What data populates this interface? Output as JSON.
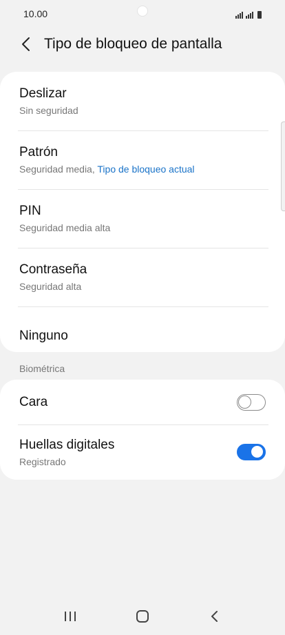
{
  "status_bar": {
    "time": "10.00"
  },
  "header": {
    "title": "Tipo de bloqueo de pantalla"
  },
  "lock_types": [
    {
      "title": "Deslizar",
      "subtitle": "Sin seguridad"
    },
    {
      "title": "Patrón",
      "subtitle": "Seguridad media,",
      "current_label": "Tipo de bloqueo actual"
    },
    {
      "title": "PIN",
      "subtitle": "Seguridad media alta"
    },
    {
      "title": "Contraseña",
      "subtitle": "Seguridad alta"
    },
    {
      "title": "Ninguno"
    }
  ],
  "biometrics": {
    "section_label": "Biométrica",
    "items": [
      {
        "title": "Cara",
        "enabled": false
      },
      {
        "title": "Huellas digitales",
        "subtitle": "Registrado",
        "enabled": true
      }
    ]
  },
  "colors": {
    "accent": "#1a73e8",
    "link": "#1a73c8",
    "background": "#f2f2f2",
    "card": "#ffffff"
  },
  "icons": {
    "back": "chevron-left-icon",
    "recents": "recents-icon",
    "home": "home-icon",
    "nav_back": "nav-back-icon"
  }
}
